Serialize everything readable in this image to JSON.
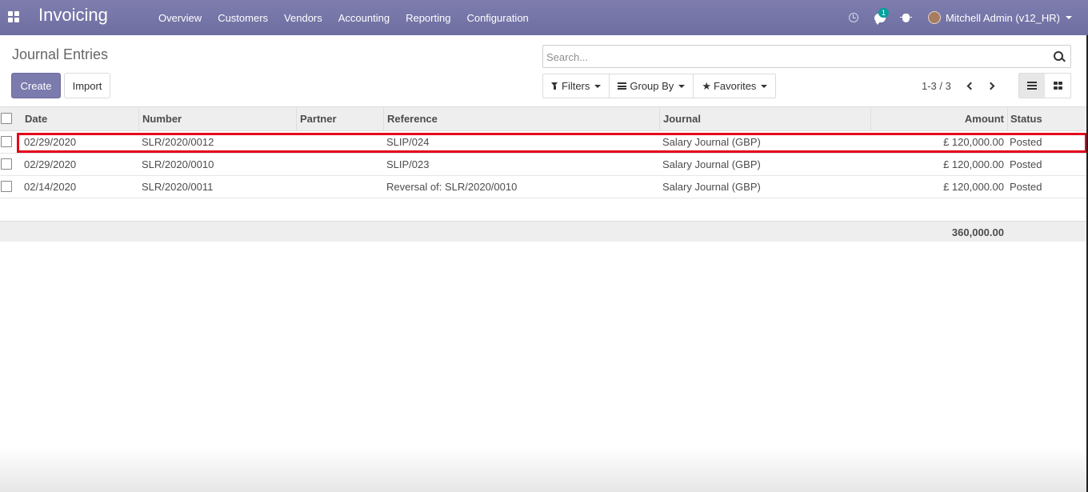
{
  "navbar": {
    "app_title": "Invoicing",
    "menu": [
      "Overview",
      "Customers",
      "Vendors",
      "Accounting",
      "Reporting",
      "Configuration"
    ],
    "messages_count": "1",
    "user_name": "Mitchell Admin (v12_HR)"
  },
  "control": {
    "breadcrumb": "Journal Entries",
    "create_label": "Create",
    "import_label": "Import",
    "search_placeholder": "Search...",
    "filters_label": "Filters",
    "group_by_label": "Group By",
    "favorites_label": "Favorites",
    "pager": "1-3 / 3"
  },
  "table": {
    "headers": [
      "Date",
      "Number",
      "Partner",
      "Reference",
      "Journal",
      "Amount",
      "Status"
    ],
    "rows": [
      {
        "date": "02/29/2020",
        "number": "SLR/2020/0012",
        "partner": "",
        "reference": "SLIP/024",
        "journal": "Salary Journal (GBP)",
        "amount": "£ 120,000.00",
        "status": "Posted"
      },
      {
        "date": "02/29/2020",
        "number": "SLR/2020/0010",
        "partner": "",
        "reference": "SLIP/023",
        "journal": "Salary Journal (GBP)",
        "amount": "£ 120,000.00",
        "status": "Posted"
      },
      {
        "date": "02/14/2020",
        "number": "SLR/2020/0011",
        "partner": "",
        "reference": "Reversal of: SLR/2020/0010",
        "journal": "Salary Journal (GBP)",
        "amount": "£ 120,000.00",
        "status": "Posted"
      }
    ],
    "total": "360,000.00"
  },
  "colors": {
    "navbar": "#7c7bad",
    "highlight": "#e3001b",
    "badge": "#00a09d"
  }
}
